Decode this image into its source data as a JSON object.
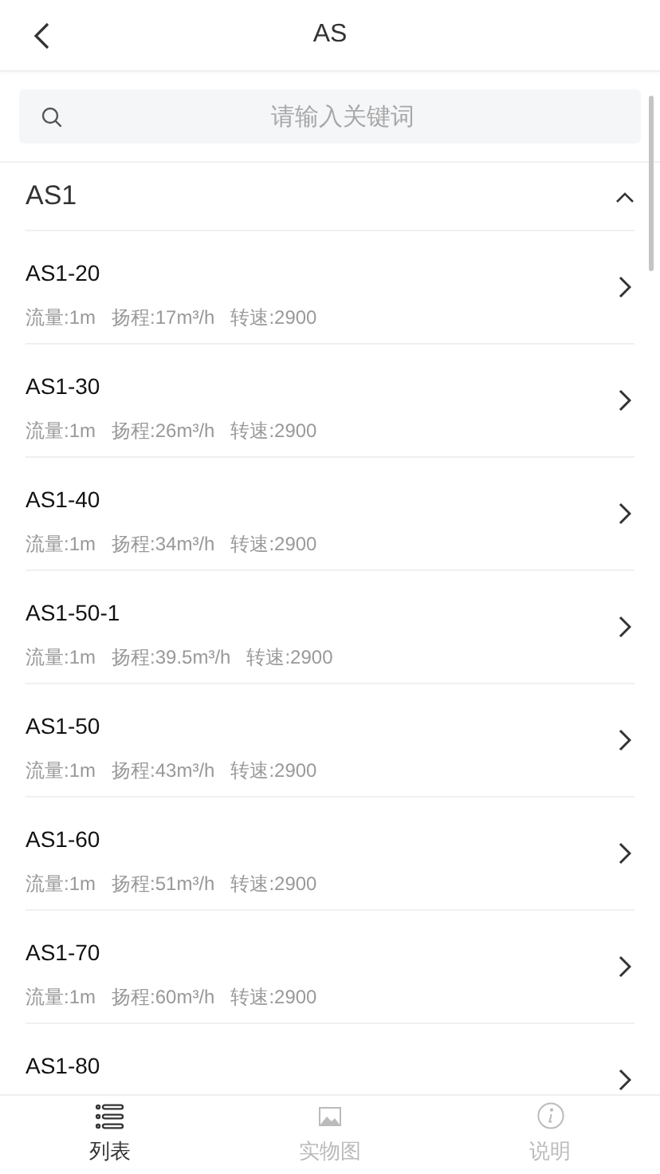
{
  "header": {
    "title": "AS"
  },
  "search": {
    "placeholder": "请输入关键词"
  },
  "group": {
    "title": "AS1",
    "expanded": true
  },
  "items": [
    {
      "name": "AS1-20",
      "specs": [
        "流量:1m",
        "扬程:17m³/h",
        "转速:2900"
      ]
    },
    {
      "name": "AS1-30",
      "specs": [
        "流量:1m",
        "扬程:26m³/h",
        "转速:2900"
      ]
    },
    {
      "name": "AS1-40",
      "specs": [
        "流量:1m",
        "扬程:34m³/h",
        "转速:2900"
      ]
    },
    {
      "name": "AS1-50-1",
      "specs": [
        "流量:1m",
        "扬程:39.5m³/h",
        "转速:2900"
      ]
    },
    {
      "name": "AS1-50",
      "specs": [
        "流量:1m",
        "扬程:43m³/h",
        "转速:2900"
      ]
    },
    {
      "name": "AS1-60",
      "specs": [
        "流量:1m",
        "扬程:51m³/h",
        "转速:2900"
      ]
    },
    {
      "name": "AS1-70",
      "specs": [
        "流量:1m",
        "扬程:60m³/h",
        "转速:2900"
      ]
    },
    {
      "name": "AS1-80"
    }
  ],
  "tabs": [
    {
      "kind": "list",
      "label": "列表",
      "selected": true
    },
    {
      "kind": "image",
      "label": "实物图",
      "selected": false
    },
    {
      "kind": "info",
      "label": "说明",
      "selected": false
    }
  ]
}
